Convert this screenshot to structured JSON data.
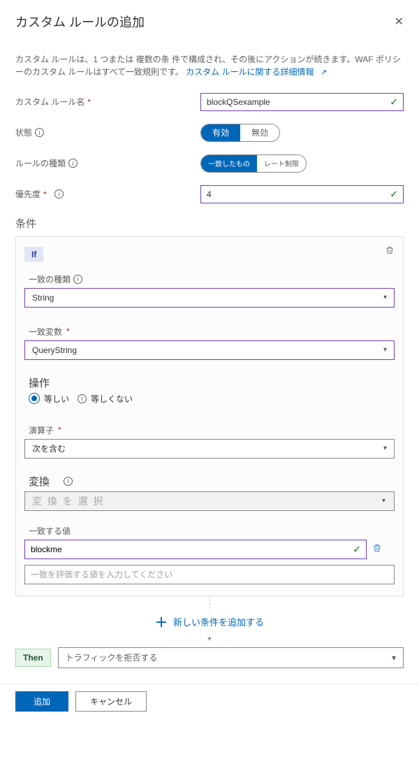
{
  "header": {
    "title": "カスタム ルールの追加"
  },
  "intro": {
    "text_prefix": "カスタム ルールは、1 つまたは 複数の条 件で構成され、その後にアクションが続きます。WAF ポリシーのカスタム ルールはすべて一致規則です。",
    "link": "カスタム ルールに関する詳細情報"
  },
  "fields": {
    "name_label": "カスタム ルール名",
    "name_value": "blockQSexample",
    "state_label": "状態",
    "state_on": "有効",
    "state_off": "無効",
    "type_label": "ルールの種類",
    "type_match": "一致したもの",
    "type_rate": "レート制限",
    "priority_label": "優先度",
    "priority_value": "4"
  },
  "conditions": {
    "section": "条件",
    "if": "If",
    "match_type_label": "一致の種類",
    "match_type_value": "String",
    "match_var_label": "一致変数",
    "match_var_value": "QueryString",
    "op_section": "操作",
    "op_equal": "等しい",
    "op_notequal": "等しくない",
    "operator_label": "演算子",
    "operator_value": "次を含む",
    "transform_label": "変換",
    "transform_placeholder": "変 換 を 選 択",
    "match_value_label": "一致する値",
    "match_value": "blockme",
    "match_value_placeholder": "一致を評価する値を入力してください",
    "add_condition": "新しい条件を追加する"
  },
  "then": {
    "label": "Then",
    "action": "トラフィックを拒否する"
  },
  "footer": {
    "add": "追加",
    "cancel": "キャンセル"
  }
}
